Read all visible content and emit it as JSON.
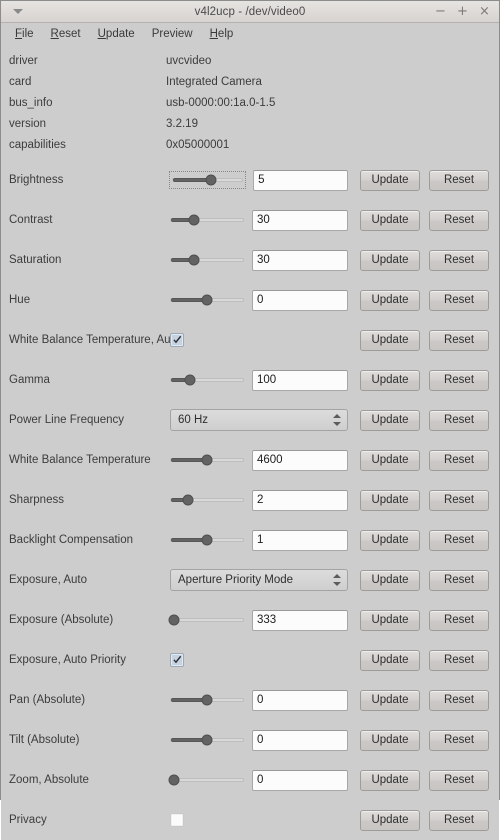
{
  "window": {
    "title": "v4l2ucp - /dev/video0",
    "menu_icon": "caret-down-icon",
    "controls": {
      "minimize": "−",
      "maximize": "+",
      "close": "×"
    }
  },
  "menubar": [
    {
      "label": "File",
      "mnemonic": "F",
      "rest": "ile"
    },
    {
      "label": "Reset",
      "mnemonic": "R",
      "rest": "eset"
    },
    {
      "label": "Update",
      "mnemonic": "U",
      "rest": "pdate"
    },
    {
      "label": "Preview",
      "mnemonic": "",
      "rest": "Preview"
    },
    {
      "label": "Help",
      "mnemonic": "H",
      "rest": "elp"
    }
  ],
  "info": [
    {
      "key": "driver",
      "value": "uvcvideo"
    },
    {
      "key": "card",
      "value": "Integrated Camera"
    },
    {
      "key": "bus_info",
      "value": "usb-0000:00:1a.0-1.5"
    },
    {
      "key": "version",
      "value": "3.2.19"
    },
    {
      "key": "capabilities",
      "value": "0x05000001"
    }
  ],
  "buttons": {
    "update_label": "Update",
    "reset_label": "Reset"
  },
  "controls": [
    {
      "label": "Brightness",
      "widget": "slider",
      "value": "5",
      "pct": 55,
      "focused": true
    },
    {
      "label": "Contrast",
      "widget": "slider",
      "value": "30",
      "pct": 32,
      "focused": false
    },
    {
      "label": "Saturation",
      "widget": "slider",
      "value": "30",
      "pct": 32,
      "focused": false
    },
    {
      "label": "Hue",
      "widget": "slider",
      "value": "0",
      "pct": 50,
      "focused": false
    },
    {
      "label": "White Balance Temperature, Auto",
      "widget": "checkbox",
      "checked": true
    },
    {
      "label": "Gamma",
      "widget": "slider",
      "value": "100",
      "pct": 27,
      "focused": false
    },
    {
      "label": "Power Line Frequency",
      "widget": "combo",
      "value": "60 Hz"
    },
    {
      "label": "White Balance Temperature",
      "widget": "slider",
      "value": "4600",
      "pct": 50,
      "focused": false
    },
    {
      "label": "Sharpness",
      "widget": "slider",
      "value": "2",
      "pct": 24,
      "focused": false
    },
    {
      "label": "Backlight Compensation",
      "widget": "slider",
      "value": "1",
      "pct": 50,
      "focused": false
    },
    {
      "label": "Exposure, Auto",
      "widget": "combo",
      "value": "Aperture Priority Mode"
    },
    {
      "label": "Exposure (Absolute)",
      "widget": "slider",
      "value": "333",
      "pct": 4,
      "focused": false
    },
    {
      "label": "Exposure, Auto Priority",
      "widget": "checkbox",
      "checked": true
    },
    {
      "label": "Pan (Absolute)",
      "widget": "slider",
      "value": "0",
      "pct": 50,
      "focused": false
    },
    {
      "label": "Tilt (Absolute)",
      "widget": "slider",
      "value": "0",
      "pct": 50,
      "focused": false
    },
    {
      "label": "Zoom, Absolute",
      "widget": "slider",
      "value": "0",
      "pct": 4,
      "focused": false
    },
    {
      "label": "Privacy",
      "widget": "checkbox",
      "checked": false
    }
  ],
  "colors": {
    "window_bg": "#cdcdcd",
    "titlebar_bg": "#dedbd8",
    "slider_fill": "#636363",
    "checkbox_on_bg": "#c5d2e0",
    "entry_bg": "#fcfcfc"
  }
}
